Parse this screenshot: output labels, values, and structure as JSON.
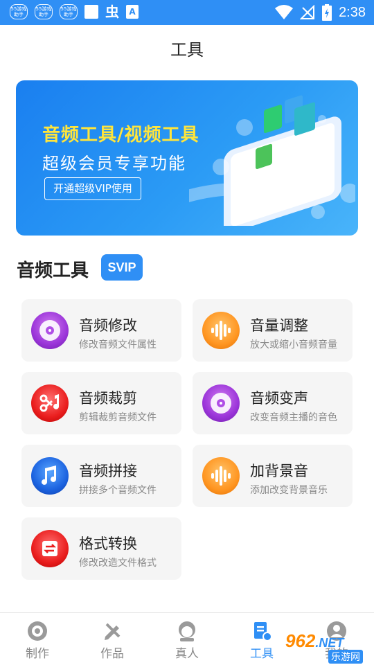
{
  "status_bar": {
    "badges": [
      "55游戏\n助手",
      "55游戏\n助手",
      "55游戏\n助手"
    ],
    "glyph_char": "虫",
    "a_char": "A",
    "time": "2:38"
  },
  "header": {
    "title": "工具"
  },
  "banner": {
    "title": "音频工具/视频工具",
    "subtitle": "超级会员专享功能",
    "button_label": "开通超级VIP使用"
  },
  "section": {
    "title": "音频工具",
    "badge": "SVIP"
  },
  "tools": [
    {
      "name": "音频修改",
      "desc": "修改音频文件属性",
      "icon": "vinyl-disc-icon",
      "color": "#9b35d9"
    },
    {
      "name": "音量调整",
      "desc": "放大或缩小音频音量",
      "icon": "sound-wave-icon",
      "color": "#ff9622"
    },
    {
      "name": "音频裁剪",
      "desc": "剪辑裁剪音频文件",
      "icon": "scissors-music-icon",
      "color": "#ea1e1e"
    },
    {
      "name": "音频变声",
      "desc": "改变音频主播的音色",
      "icon": "vinyl-disc-icon",
      "color": "#9b35d9"
    },
    {
      "name": "音频拼接",
      "desc": "拼接多个音频文件",
      "icon": "music-notes-icon",
      "color": "#1c63e0"
    },
    {
      "name": "加背景音",
      "desc": "添加改变背景音乐",
      "icon": "sound-wave-icon",
      "color": "#ff9622"
    },
    {
      "name": "格式转换",
      "desc": "修改改造文件格式",
      "icon": "convert-icon",
      "color": "#ea1e1e"
    }
  ],
  "bottom_nav": [
    {
      "label": "制作",
      "icon": "disc-icon",
      "active": false
    },
    {
      "label": "作品",
      "icon": "pencil-ruler-icon",
      "active": false
    },
    {
      "label": "真人",
      "icon": "person-face-icon",
      "active": false
    },
    {
      "label": "工具",
      "icon": "tool-doc-icon",
      "active": true
    },
    {
      "label": "我的",
      "icon": "user-icon",
      "active": false
    }
  ],
  "watermark": {
    "text": "962",
    "net": ".NET",
    "cn": "乐游网"
  },
  "colors": {
    "accent": "#2f8ff5",
    "banner_title": "#ffe53b"
  }
}
